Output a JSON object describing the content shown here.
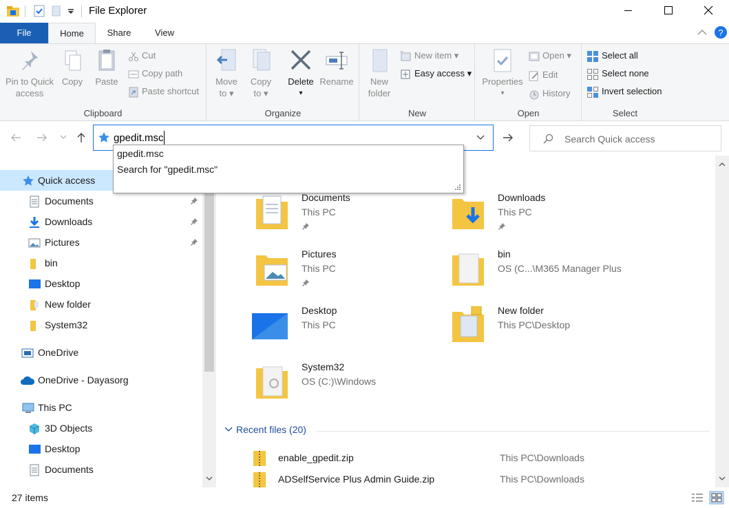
{
  "window": {
    "title": "File Explorer"
  },
  "tabs": {
    "file": "File",
    "home": "Home",
    "share": "Share",
    "view": "View"
  },
  "ribbon": {
    "clipboard": {
      "label": "Clipboard",
      "pin_line1": "Pin to Quick",
      "pin_line2": "access",
      "copy": "Copy",
      "paste": "Paste",
      "cut": "Cut",
      "copy_path": "Copy path",
      "paste_shortcut": "Paste shortcut"
    },
    "organize": {
      "label": "Organize",
      "move_line1": "Move",
      "move_line2": "to",
      "copy_line1": "Copy",
      "copy_line2": "to",
      "delete": "Delete",
      "rename": "Rename"
    },
    "new": {
      "label": "New",
      "folder_line1": "New",
      "folder_line2": "folder",
      "new_item": "New item",
      "easy_access": "Easy access"
    },
    "open": {
      "label": "Open",
      "properties": "Properties",
      "open": "Open",
      "edit": "Edit",
      "history": "History"
    },
    "select": {
      "label": "Select",
      "select_all": "Select all",
      "select_none": "Select none",
      "invert": "Invert selection"
    }
  },
  "address": {
    "value": "gpedit.msc"
  },
  "search": {
    "placeholder": "Search Quick access"
  },
  "autocomplete": {
    "items": [
      "gpedit.msc",
      "Search for \"gpedit.msc\""
    ]
  },
  "nav": {
    "quick_access": "Quick access",
    "quick_items": [
      "Documents",
      "Downloads",
      "Pictures",
      "bin",
      "Desktop",
      "New folder",
      "System32"
    ],
    "onedrive": "OneDrive",
    "onedrive_org": "OneDrive - Dayasorg",
    "this_pc": "This PC",
    "pc_items": [
      "3D Objects",
      "Desktop",
      "Documents"
    ]
  },
  "folders": [
    {
      "name": "Documents",
      "path": "This PC"
    },
    {
      "name": "Downloads",
      "path": "This PC"
    },
    {
      "name": "Pictures",
      "path": "This PC"
    },
    {
      "name": "bin",
      "path": "OS (C...\\M365 Manager Plus"
    },
    {
      "name": "Desktop",
      "path": "This PC"
    },
    {
      "name": "New folder",
      "path": "This PC\\Desktop"
    },
    {
      "name": "System32",
      "path": "OS (C:)\\Windows"
    }
  ],
  "recent": {
    "header": "Recent files (20)",
    "files": [
      {
        "name": "enable_gpedit.zip",
        "path": "This PC\\Downloads"
      },
      {
        "name": "ADSelfService Plus Admin Guide.zip",
        "path": "This PC\\Downloads"
      }
    ]
  },
  "status": {
    "items": "27 items"
  },
  "colors": {
    "accent": "#1a5fb4",
    "selection": "#cce8ff",
    "folder": "#f4c542"
  }
}
